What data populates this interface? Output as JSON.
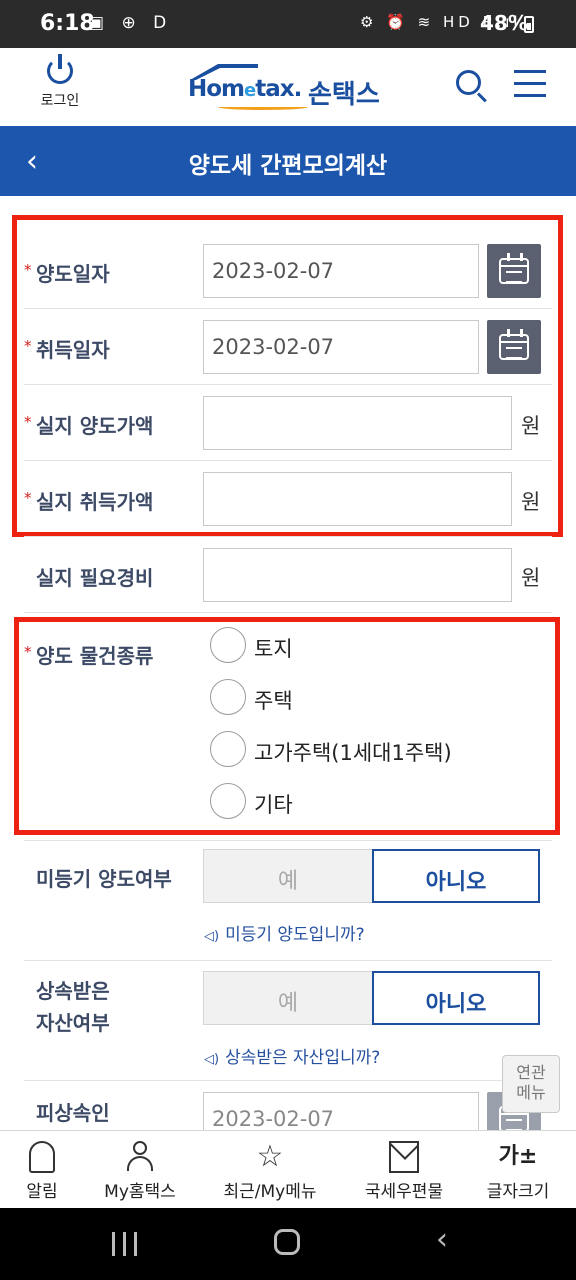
{
  "status_bar": {
    "time": "6:18",
    "left_icons": "▣ ⊕ D",
    "right_icons": "⚙ ⏰ ≋ HD R.ıl",
    "battery": "48%"
  },
  "header": {
    "login_label": "로그인",
    "logo_text_home": "Hom",
    "logo_text_e": "e",
    "logo_text_tax": "tax.",
    "logo_text_kr": "손택스"
  },
  "titlebar": {
    "back_icon": "‹",
    "title": "양도세 간편모의계산"
  },
  "form": {
    "transfer_date": {
      "label": "양도일자",
      "value": "2023-02-07"
    },
    "acquisition_date": {
      "label": "취득일자",
      "value": "2023-02-07"
    },
    "transfer_price": {
      "label": "실지 양도가액",
      "value": "",
      "unit": "원"
    },
    "acquisition_price": {
      "label": "실지 취득가액",
      "value": "",
      "unit": "원"
    },
    "necessary_expense": {
      "label": "실지 필요경비",
      "value": "",
      "unit": "원"
    },
    "property_type": {
      "label": "양도 물건종류",
      "options": [
        "토지",
        "주택",
        "고가주택(1세대1주택)",
        "기타"
      ]
    },
    "unregistered": {
      "label": "미등기 양도여부",
      "yes": "예",
      "no": "아니오",
      "hint": "미등기 양도입니까?"
    },
    "inherited": {
      "label_line1": "상속받은",
      "label_line2": "자산여부",
      "yes": "예",
      "no": "아니오",
      "hint": "상속받은 자산입니까?"
    },
    "decedent": {
      "label": "피상속인",
      "value": "2023-02-07"
    },
    "required_mark": "*"
  },
  "related_menu": {
    "line1": "연관",
    "line2": "메뉴"
  },
  "bottom_nav": [
    {
      "label": "알림",
      "icon": "bell-icon"
    },
    {
      "label": "My홈택스",
      "icon": "person-icon"
    },
    {
      "label": "최근/My메뉴",
      "icon": "star-icon"
    },
    {
      "label": "국세우편물",
      "icon": "envelope-icon"
    },
    {
      "label": "글자크기",
      "icon": "font-size-icon",
      "glyph": "가±"
    }
  ],
  "colors": {
    "brand_blue": "#1c56ad",
    "highlight_red": "#ee2211",
    "label_color": "#3d4a66"
  }
}
